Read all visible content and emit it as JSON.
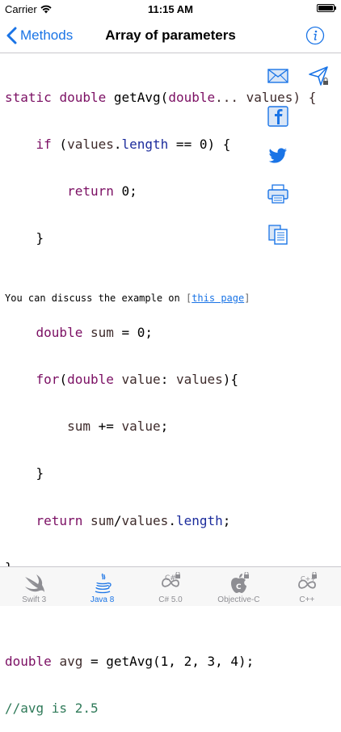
{
  "status_bar": {
    "carrier": "Carrier",
    "time": "11:15 AM"
  },
  "nav": {
    "back_label": "Methods",
    "title": "Array of parameters"
  },
  "code": {
    "l1_kw1": "static",
    "l1_kw2": "double",
    "l1_fn": "getAvg",
    "l1_kw3": "double",
    "l1_rest": "... values) {",
    "l2_kw": "if",
    "l2_id": "values",
    "l2_prop": "length",
    "l2_rest": " == 0) {",
    "l3_kw": "return",
    "l3_rest": " 0;",
    "l4": "}",
    "l6_kw": "double",
    "l6_id": "sum",
    "l6_rest": " = 0;",
    "l7_kw": "for",
    "l7_kw2": "double",
    "l7_id": "value",
    "l7_id2": "values",
    "l7_rest": "){",
    "l8_id": "sum",
    "l8_mid": " += ",
    "l8_id2": "value",
    "l8_rest": ";",
    "l9": "}",
    "l10_kw": "return",
    "l10_id": "sum",
    "l10_id2": "values",
    "l10_prop": "length",
    "l10_rest": ";",
    "l11": "}",
    "l13_kw": "double",
    "l13_id": "avg",
    "l13_rest": " = getAvg(1, 2, 3, 4);",
    "l14_cm": "//avg is 2.5"
  },
  "discussion": {
    "prefix": "You can discuss the example on ",
    "link_text": "this page"
  },
  "share": [
    "email-icon",
    "facebook-icon",
    "twitter-icon",
    "print-icon",
    "copy-icon"
  ],
  "tabs": [
    {
      "label": "Swift 3",
      "icon": "swift-icon"
    },
    {
      "label": "Java 8",
      "icon": "java-icon"
    },
    {
      "label": "C# 5.0",
      "icon": "csharp-icon"
    },
    {
      "label": "Objective-C",
      "icon": "objc-icon"
    },
    {
      "label": "C++",
      "icon": "cpp-icon"
    }
  ],
  "colors": {
    "accent": "#1a74e6",
    "keyword": "#7b0f63",
    "comment": "#2f7a59"
  }
}
